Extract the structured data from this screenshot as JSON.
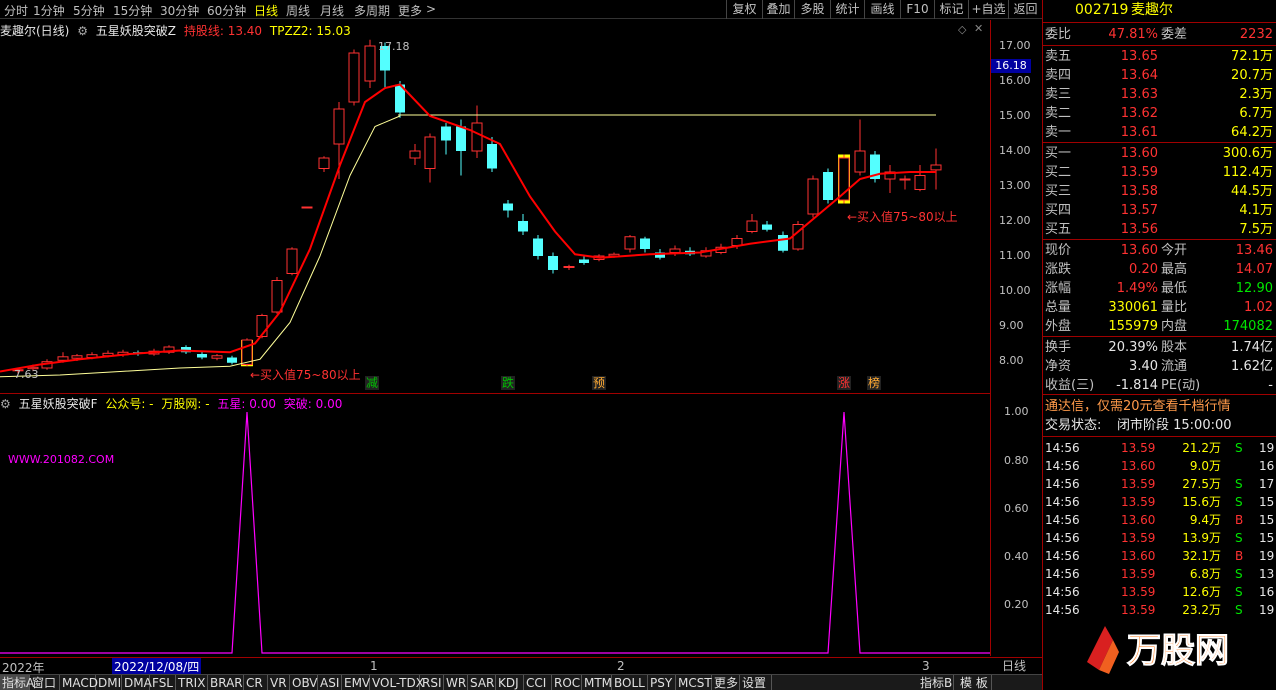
{
  "toolbar": {
    "periods": [
      "分时",
      "1分钟",
      "5分钟",
      "15分钟",
      "30分钟",
      "60分钟",
      "日线",
      "周线",
      "月线",
      "多周期",
      "更多"
    ],
    "active_period": "日线",
    "buttons": [
      "复权",
      "叠加",
      "多股",
      "统计",
      "画线",
      "F10",
      "标记",
      "+自选",
      "返回"
    ]
  },
  "main_title": {
    "stock": "麦趣尔(日线)",
    "indicator": "五星妖股突破Z",
    "line1_label": "持股线: 13.40",
    "line2_label": "TPZZ2: 15.03"
  },
  "price_axis": {
    "labels": [
      "17.00",
      "16.00",
      "15.00",
      "14.00",
      "13.00",
      "12.00",
      "11.00",
      "10.00",
      "9.00",
      "8.00"
    ],
    "current": "16.18"
  },
  "annotations": {
    "high_label": "17.18",
    "low_label": "7.63",
    "buy1": "←买入值75~80以上",
    "buy2": "←买入值75~80以上",
    "tags": [
      "减",
      "跌",
      "预",
      "涨",
      "榜"
    ]
  },
  "sub_title": {
    "indicator": "五星妖股突破F",
    "gzh": "公众号: -",
    "wgw": "万股网: -",
    "wuxing": "五星: 0.00",
    "tupo": "突破: 0.00",
    "url": "WWW.201082.COM"
  },
  "sub_axis": {
    "labels": [
      "1.00",
      "0.80",
      "0.60",
      "0.40",
      "0.20"
    ]
  },
  "time_axis": {
    "year": "2022年",
    "cursor_date": "2022/12/08/四",
    "marks": [
      "1",
      "2",
      "3"
    ],
    "period_label": "日线"
  },
  "indicator_tabs": [
    "指标A",
    "窗口",
    "MACD",
    "DMI",
    "DMA",
    "FSL",
    "TRIX",
    "BRAR",
    "CR",
    "VR",
    "OBV",
    "ASI",
    "EMV",
    "VOL-TDX",
    "RSI",
    "WR",
    "SAR",
    "KDJ",
    "CCI",
    "ROC",
    "MTM",
    "BOLL",
    "PSY",
    "MCST",
    "更多",
    "设置",
    "指标B",
    "模 板"
  ],
  "quote": {
    "code": "002719",
    "name": "麦趣尔",
    "weibi_label": "委比",
    "weibi": "47.81%",
    "weicha_label": "委差",
    "weicha": "2232",
    "asks": [
      {
        "label": "卖五",
        "price": "13.65",
        "vol": "72.1万"
      },
      {
        "label": "卖四",
        "price": "13.64",
        "vol": "20.7万"
      },
      {
        "label": "卖三",
        "price": "13.63",
        "vol": "2.3万"
      },
      {
        "label": "卖二",
        "price": "13.62",
        "vol": "6.7万"
      },
      {
        "label": "卖一",
        "price": "13.61",
        "vol": "64.2万"
      }
    ],
    "bids": [
      {
        "label": "买一",
        "price": "13.60",
        "vol": "300.6万"
      },
      {
        "label": "买二",
        "price": "13.59",
        "vol": "112.4万"
      },
      {
        "label": "买三",
        "price": "13.58",
        "vol": "44.5万"
      },
      {
        "label": "买四",
        "price": "13.57",
        "vol": "4.1万"
      },
      {
        "label": "买五",
        "price": "13.56",
        "vol": "7.5万"
      }
    ],
    "stats": [
      {
        "l1": "现价",
        "v1": "13.60",
        "l2": "今开",
        "v2": "13.46"
      },
      {
        "l1": "涨跌",
        "v1": "0.20",
        "l2": "最高",
        "v2": "14.07"
      },
      {
        "l1": "涨幅",
        "v1": "1.49%",
        "l2": "最低",
        "v2": "12.90"
      },
      {
        "l1": "总量",
        "v1": "330061",
        "l2": "量比",
        "v2": "1.02"
      },
      {
        "l1": "外盘",
        "v1": "155979",
        "l2": "内盘",
        "v2": "174082"
      }
    ],
    "stats2": [
      {
        "l1": "换手",
        "v1": "20.39%",
        "l2": "股本",
        "v2": "1.74亿"
      },
      {
        "l1": "净资",
        "v1": "3.40",
        "l2": "流通",
        "v2": "1.62亿"
      },
      {
        "l1": "收益(三)",
        "v1": "-1.814",
        "l2": "PE(动)",
        "v2": "-"
      }
    ],
    "promo": "通达信，仅需20元查看千档行情",
    "status_label": "交易状态:",
    "status": "闭市阶段 15:00:00"
  },
  "ticks": [
    {
      "t": "14:56",
      "p": "13.59",
      "v": "21.2万",
      "s": "S",
      "n": "19"
    },
    {
      "t": "14:56",
      "p": "13.60",
      "v": "9.0万",
      "s": "",
      "n": "16"
    },
    {
      "t": "14:56",
      "p": "13.59",
      "v": "27.5万",
      "s": "S",
      "n": "17"
    },
    {
      "t": "14:56",
      "p": "13.59",
      "v": "15.6万",
      "s": "S",
      "n": "15"
    },
    {
      "t": "14:56",
      "p": "13.60",
      "v": "9.4万",
      "s": "B",
      "n": "15"
    },
    {
      "t": "14:56",
      "p": "13.59",
      "v": "13.9万",
      "s": "S",
      "n": "15"
    },
    {
      "t": "14:56",
      "p": "13.60",
      "v": "32.1万",
      "s": "B",
      "n": "19"
    },
    {
      "t": "14:56",
      "p": "13.59",
      "v": "6.8万",
      "s": "S",
      "n": "13"
    },
    {
      "t": "14:56",
      "p": "13.59",
      "v": "12.6万",
      "s": "S",
      "n": "16"
    },
    {
      "t": "14:56",
      "p": "13.59",
      "v": "23.2万",
      "s": "S",
      "n": "19"
    }
  ],
  "watermark": "万股网",
  "colors": {
    "up": "#ff3232",
    "down": "#54ffff",
    "ma": "#ff0000",
    "yellowline": "#ffff99",
    "signal": "#ff00ff"
  }
}
